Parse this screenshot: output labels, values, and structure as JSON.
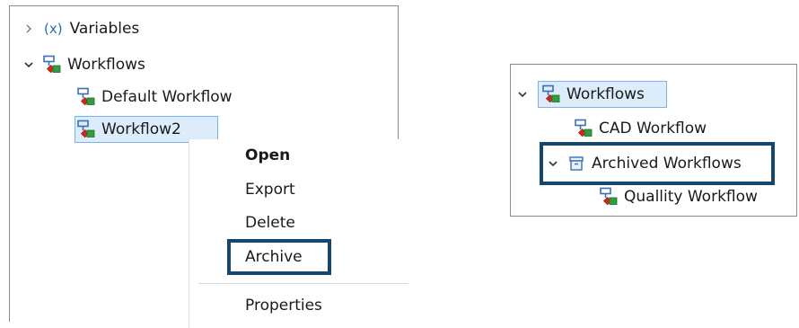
{
  "left_tree": {
    "variables": {
      "prefix": "(x)",
      "label": "Variables"
    },
    "workflows": {
      "label": "Workflows"
    },
    "default_workflow": {
      "label": "Default Workflow"
    },
    "workflow2": {
      "label": "Workflow2"
    }
  },
  "context_menu": {
    "items": [
      "Open",
      "Export",
      "Delete",
      "Archive",
      "Properties"
    ]
  },
  "right_tree": {
    "workflows": {
      "label": "Workflows"
    },
    "cad_workflow": {
      "label": "CAD Workflow"
    },
    "archived": {
      "label": "Archived Workflows"
    },
    "quality": {
      "label": "Quallity Workflow"
    }
  },
  "colors": {
    "highlight_border": "#14466e",
    "selection_fill": "#dcecfb",
    "selection_border": "#7ab3e8",
    "icon_red": "#cc2a1f",
    "icon_green": "#2e9e3e",
    "icon_frame": "#3b6fb5",
    "variables_blue": "#2b6cb0"
  },
  "icons": [
    "chevron-right-icon",
    "chevron-down-icon",
    "workflow-icon",
    "archive-folder-icon"
  ]
}
